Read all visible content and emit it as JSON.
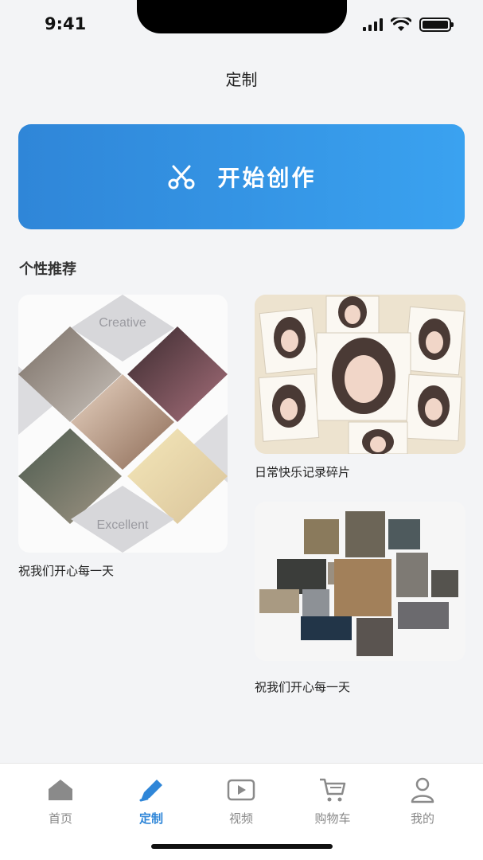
{
  "status_bar": {
    "time": "9:41"
  },
  "header": {
    "title": "定制"
  },
  "create_button": {
    "label": "开始创作",
    "icon": "scissors-icon",
    "color_start": "#2f86d8",
    "color_end": "#3aa2f0"
  },
  "section": {
    "title": "个性推荐"
  },
  "cards": [
    {
      "caption": "祝我们开心每一天",
      "collage_text_top": "Creative",
      "collage_text_bottom": "Excellent"
    },
    {
      "caption": "日常快乐记录碎片"
    },
    {
      "caption": "祝我们开心每一天"
    }
  ],
  "tab_bar": {
    "items": [
      {
        "label": "首页",
        "icon": "home-icon",
        "active": false
      },
      {
        "label": "定制",
        "icon": "pen-icon",
        "active": true
      },
      {
        "label": "视频",
        "icon": "video-icon",
        "active": false
      },
      {
        "label": "购物车",
        "icon": "cart-icon",
        "active": false
      },
      {
        "label": "我的",
        "icon": "user-icon",
        "active": false
      }
    ],
    "active_color": "#2f86d8",
    "inactive_color": "#888888"
  }
}
